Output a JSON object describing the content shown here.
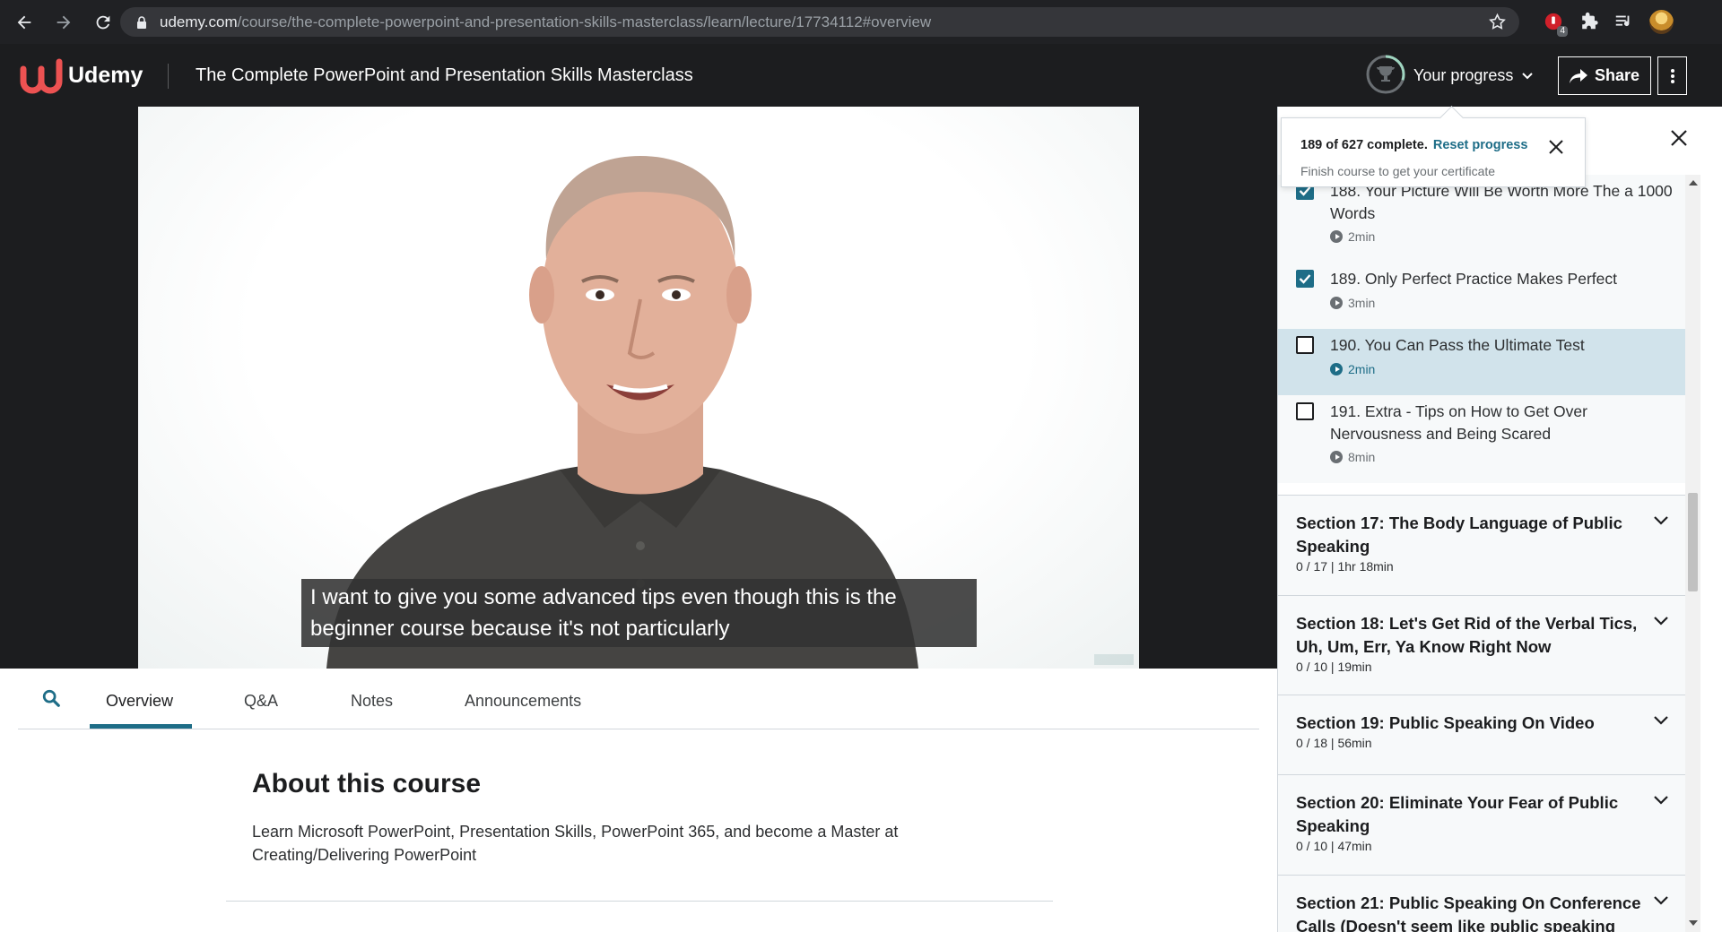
{
  "browser": {
    "url_domain": "udemy.com",
    "url_path": "/course/the-complete-powerpoint-and-presentation-skills-masterclass/learn/lecture/17734112#overview",
    "extension_badge": "4"
  },
  "header": {
    "logo_text": "Udemy",
    "course_title": "The Complete PowerPoint and Presentation Skills Masterclass",
    "progress_label": "Your progress",
    "share_label": "Share"
  },
  "video": {
    "caption_line1": "I want to give you some advanced tips even though this is the",
    "caption_line2": "beginner course because it's not particularly"
  },
  "tabs": [
    {
      "label": "Overview",
      "active": true
    },
    {
      "label": "Q&A",
      "active": false
    },
    {
      "label": "Notes",
      "active": false
    },
    {
      "label": "Announcements",
      "active": false
    }
  ],
  "about": {
    "heading": "About this course",
    "description": "Learn Microsoft PowerPoint, Presentation Skills, PowerPoint 365, and become a Master at Creating/Delivering PowerPoint"
  },
  "progress_popover": {
    "status": "189 of 627 complete.",
    "reset_label": "Reset progress",
    "hint": "Finish course to get your certificate",
    "completed": 189,
    "total": 627
  },
  "lectures": [
    {
      "title": "188. Your Picture Will Be Worth More The a 1000 Words",
      "duration": "2min",
      "checked": true,
      "current": false
    },
    {
      "title": "189. Only Perfect Practice Makes Perfect",
      "duration": "3min",
      "checked": true,
      "current": false
    },
    {
      "title": "190. You Can Pass the Ultimate Test",
      "duration": "2min",
      "checked": false,
      "current": true
    },
    {
      "title": "191. Extra - Tips on How to Get Over Nervousness and Being Scared",
      "duration": "8min",
      "checked": false,
      "current": false
    }
  ],
  "sections": [
    {
      "title": "Section 17: The Body Language of Public Speaking",
      "meta": "0 / 17 | 1hr 18min"
    },
    {
      "title": "Section 18: Let's Get Rid of the Verbal Tics, Uh, Um, Err, Ya Know Right Now",
      "meta": "0 / 10 | 19min"
    },
    {
      "title": "Section 19: Public Speaking On Video",
      "meta": "0 / 18 | 56min"
    },
    {
      "title": "Section 20: Eliminate Your Fear of Public Speaking",
      "meta": "0 / 10 | 47min"
    },
    {
      "title": "Section 21: Public Speaking On Conference Calls (Doesn't seem like public speaking",
      "meta": ""
    }
  ],
  "colors": {
    "accent": "#1e6d87",
    "header_bg": "#1c1d1f",
    "udemy_red": "#a435f0"
  }
}
